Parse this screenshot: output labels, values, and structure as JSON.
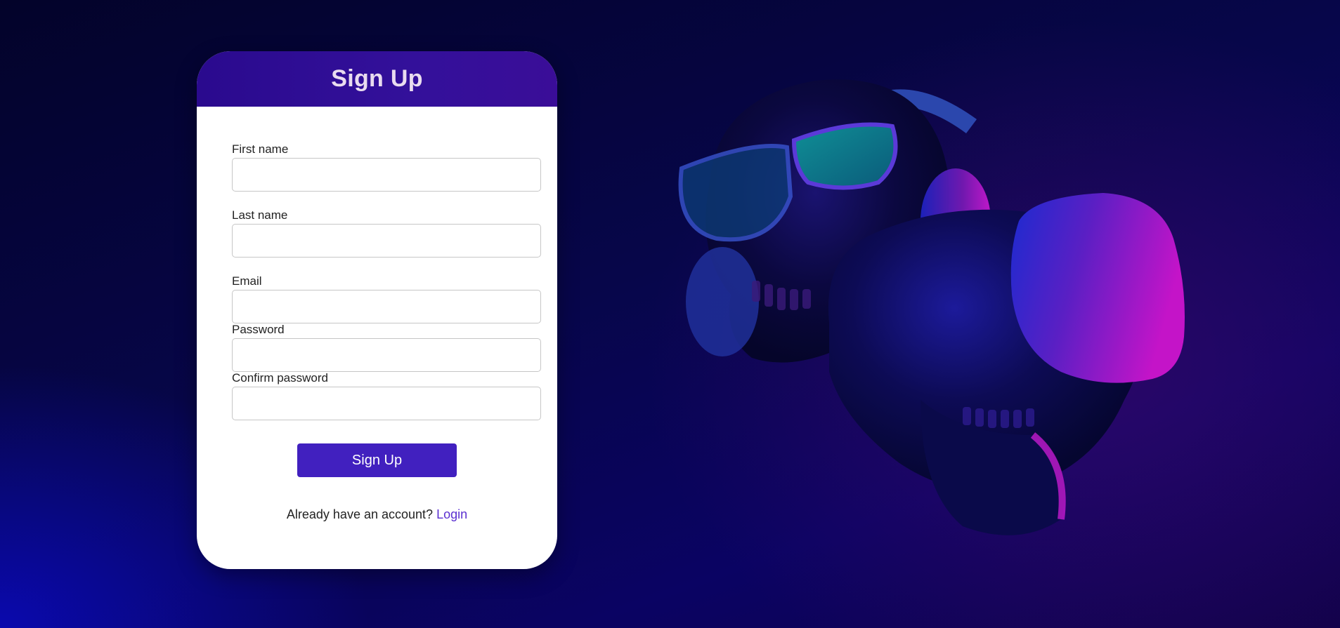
{
  "form": {
    "title": "Sign Up",
    "fields": [
      {
        "label": "First name",
        "value": "",
        "placeholder": ""
      },
      {
        "label": "Last name",
        "value": "",
        "placeholder": ""
      },
      {
        "label": "Email",
        "value": "",
        "placeholder": ""
      },
      {
        "label": "Password",
        "value": "",
        "placeholder": ""
      },
      {
        "label": "Confirm password",
        "value": "",
        "placeholder": ""
      }
    ],
    "submit_label": "Sign Up",
    "login_prompt": "Already have an account?",
    "login_link": "Login"
  },
  "illustration": {
    "icon": "skulls-vr-headphones-illustration"
  },
  "colors": {
    "header": "#33109a",
    "button": "#4120bf",
    "link": "#5a2fd0",
    "background": "#07064a"
  }
}
